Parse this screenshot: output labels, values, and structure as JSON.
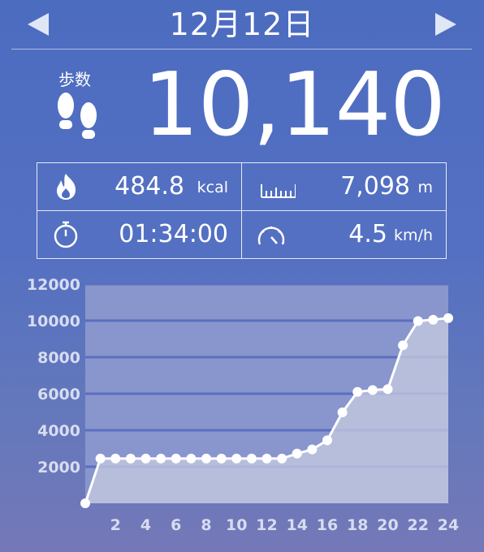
{
  "header": {
    "date": "12月12日",
    "prev_icon": "triangle-left-icon",
    "next_icon": "triangle-right-icon"
  },
  "steps": {
    "label": "歩数",
    "value": "10,140",
    "icon": "footprints-icon"
  },
  "stats": {
    "calories": {
      "value": "484.8",
      "unit": "kcal",
      "icon": "flame-icon"
    },
    "distance": {
      "value": "7,098",
      "unit": "m",
      "icon": "ruler-icon"
    },
    "time": {
      "value": "01:34:00",
      "unit": "",
      "icon": "stopwatch-icon"
    },
    "speed": {
      "value": "4.5",
      "unit": "km/h",
      "icon": "speedometer-icon"
    }
  },
  "chart_data": {
    "type": "area",
    "x": [
      0,
      1,
      2,
      3,
      4,
      5,
      6,
      7,
      8,
      9,
      10,
      11,
      12,
      13,
      14,
      15,
      16,
      17,
      18,
      19,
      20,
      21,
      22,
      23,
      24
    ],
    "values": [
      0,
      2450,
      2450,
      2450,
      2450,
      2450,
      2450,
      2450,
      2450,
      2450,
      2450,
      2450,
      2450,
      2450,
      2720,
      2950,
      3450,
      4980,
      6100,
      6200,
      6250,
      8650,
      9980,
      10050,
      10140
    ],
    "ylim": [
      0,
      12000
    ],
    "xlim": [
      0,
      24
    ],
    "y_ticks": [
      "2000",
      "4000",
      "6000",
      "8000",
      "10000",
      "12000"
    ],
    "x_ticks": [
      "2",
      "4",
      "6",
      "8",
      "10",
      "12",
      "14",
      "16",
      "18",
      "20",
      "22",
      "24"
    ],
    "grid": true,
    "colors": {
      "line": "#ffffff",
      "fill": "#c7cbe0",
      "grid": "#5c6fbf",
      "plot_bg": "#8896cd"
    }
  }
}
